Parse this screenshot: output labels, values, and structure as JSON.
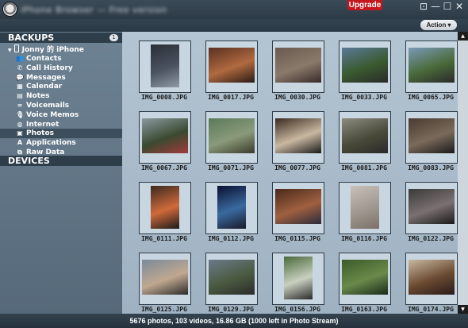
{
  "window": {
    "blurred_title": "iPhone Browser — Free version",
    "upgrade_label": "Upgrade",
    "controls": [
      "min-icon",
      "restore-icon",
      "close-icon"
    ]
  },
  "toolbar": {
    "action_label": "Action ▾"
  },
  "sidebar": {
    "backups_header": "BACKUPS",
    "backups_count": "1",
    "device_name": "Jonny 的 iPhone",
    "items": [
      {
        "label": "Contacts",
        "icon": "contacts-icon",
        "glyph": "👥"
      },
      {
        "label": "Call History",
        "icon": "phone-icon",
        "glyph": "✆"
      },
      {
        "label": "Messages",
        "icon": "messages-icon",
        "glyph": "💬"
      },
      {
        "label": "Calendar",
        "icon": "calendar-icon",
        "glyph": "▦"
      },
      {
        "label": "Notes",
        "icon": "notes-icon",
        "glyph": "▤"
      },
      {
        "label": "Voicemails",
        "icon": "voicemail-icon",
        "glyph": "∞"
      },
      {
        "label": "Voice Memos",
        "icon": "microphone-icon",
        "glyph": "🎙"
      },
      {
        "label": "Internet",
        "icon": "globe-icon",
        "glyph": "◍"
      },
      {
        "label": "Photos",
        "icon": "photos-icon",
        "glyph": "▣",
        "selected": true
      },
      {
        "label": "Applications",
        "icon": "applications-icon",
        "glyph": "A"
      },
      {
        "label": "Raw Data",
        "icon": "raw-data-icon",
        "glyph": "⧉"
      }
    ],
    "devices_header": "DEVICES"
  },
  "photos": [
    {
      "name": "IMG_0008.JPG",
      "colors": [
        "#2b2f35",
        "#4a5260",
        "#909aa5"
      ]
    },
    {
      "name": "IMG_0017.JPG",
      "colors": [
        "#5a3020",
        "#b06a40",
        "#2a1a14"
      ]
    },
    {
      "name": "IMG_0030.JPG",
      "colors": [
        "#6a5a50",
        "#8a7a6a",
        "#3a2a2a"
      ]
    },
    {
      "name": "IMG_0033.JPG",
      "colors": [
        "#5a7a98",
        "#3a5a30",
        "#2a2a2a"
      ]
    },
    {
      "name": "IMG_0065.JPG",
      "colors": [
        "#7a9ab8",
        "#4a6a3a",
        "#2a2a2a"
      ]
    },
    {
      "name": "IMG_0067.JPG",
      "colors": [
        "#8a9aa0",
        "#3a4a30",
        "#a03a3a"
      ]
    },
    {
      "name": "IMG_0071.JPG",
      "colors": [
        "#5a7a5a",
        "#8a9a7a",
        "#3a3a2a"
      ]
    },
    {
      "name": "IMG_0077.JPG",
      "colors": [
        "#3a2a20",
        "#c9b8a0",
        "#1a1a1a"
      ]
    },
    {
      "name": "IMG_0081.JPG",
      "colors": [
        "#8a8a80",
        "#4a4a3a",
        "#2a2a2a"
      ]
    },
    {
      "name": "IMG_0083.JPG",
      "colors": [
        "#4a3a30",
        "#7a6a5a",
        "#1a1a1a"
      ]
    },
    {
      "name": "IMG_0111.JPG",
      "colors": [
        "#3a2a20",
        "#d06a3a",
        "#1a1a1a"
      ]
    },
    {
      "name": "IMG_0112.JPG",
      "colors": [
        "#0a1030",
        "#3a6aa0",
        "#1a1a2a"
      ]
    },
    {
      "name": "IMG_0115.JPG",
      "colors": [
        "#4a2a1a",
        "#a06040",
        "#2a2a3a"
      ]
    },
    {
      "name": "IMG_0116.JPG",
      "colors": [
        "#c8c0b8",
        "#a09890",
        "#7a7068"
      ]
    },
    {
      "name": "IMG_0122.JPG",
      "colors": [
        "#3a3a3a",
        "#7a7070",
        "#1a1a1a"
      ]
    },
    {
      "name": "IMG_0125.JPG",
      "colors": [
        "#7a8a9a",
        "#c0a890",
        "#2a2a2a"
      ]
    },
    {
      "name": "IMG_0129.JPG",
      "colors": [
        "#6a7a8a",
        "#4a5a40",
        "#2a2a2a"
      ]
    },
    {
      "name": "IMG_0156.JPG",
      "colors": [
        "#4a6a3a",
        "#c8d0c0",
        "#2a2a2a"
      ]
    },
    {
      "name": "IMG_0163.JPG",
      "colors": [
        "#3a5a2a",
        "#6a8a4a",
        "#1a2a1a"
      ]
    },
    {
      "name": "IMG_0174.JPG",
      "colors": [
        "#c8b8a0",
        "#6a4a30",
        "#2a1a1a"
      ]
    }
  ],
  "status": {
    "text": "5676 photos, 103 videos, 16.86 GB (1000 left in Photo Stream)"
  }
}
